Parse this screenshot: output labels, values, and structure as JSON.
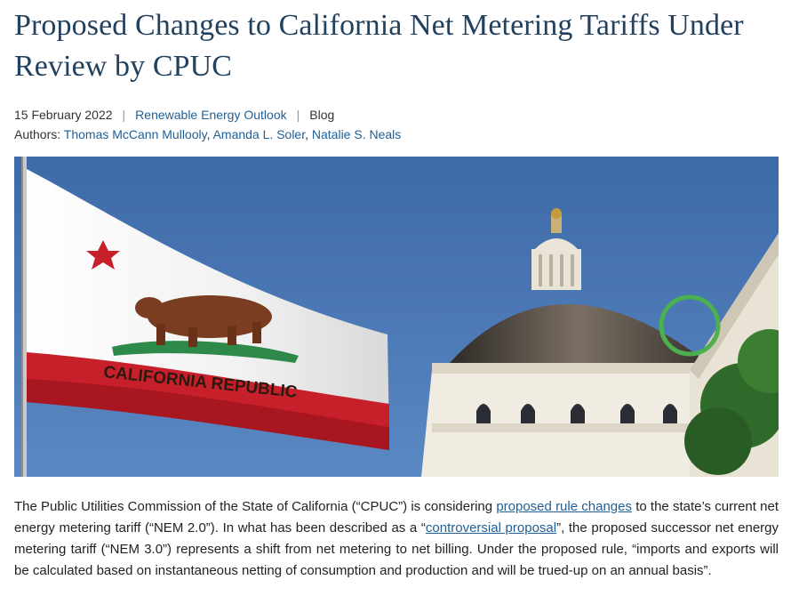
{
  "article": {
    "title": "Proposed Changes to California Net Metering Tariffs Under Review by CPUC",
    "date": "15 February 2022",
    "publication": "Renewable Energy Outlook",
    "type": "Blog",
    "authors_label": "Authors:",
    "authors": [
      "Thomas McCann Mullooly",
      "Amanda L. Soler",
      "Natalie S. Neals"
    ]
  },
  "hero": {
    "flag_text": "CALIFORNIA REPUBLIC"
  },
  "paragraph": {
    "t1": "The Public Utilities Commission of the State of California (“CPUC”) is considering ",
    "link1": "proposed rule changes",
    "t2": " to the state’s current net energy metering tariff (“NEM 2.0”).  In what has been described as a “",
    "link2": "controversial proposal",
    "t3": "”, the proposed successor net energy metering tariff (“NEM 3.0”) represents a shift from net metering to net billing.  Under the proposed rule, “imports and exports will be calculated based on instantaneous netting of consumption and production and will be trued-up on an annual basis”."
  },
  "colors": {
    "title": "#22415f",
    "link": "#1f5f96",
    "highlight_ring": "#4caf50"
  }
}
